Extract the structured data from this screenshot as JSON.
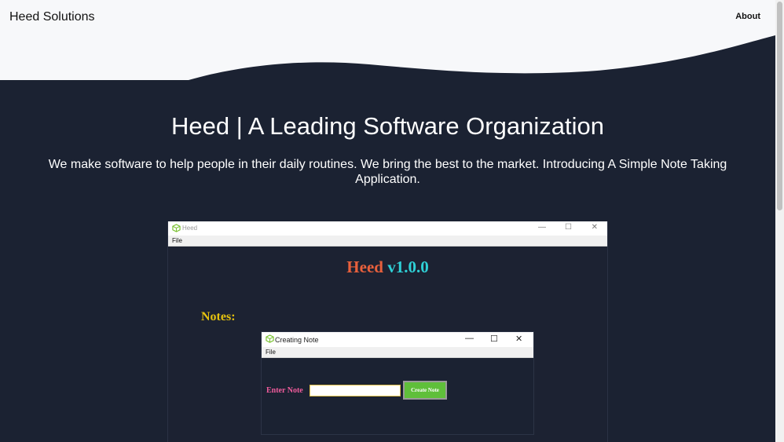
{
  "header": {
    "brand": "Heed Solutions",
    "nav": {
      "about": "About"
    }
  },
  "hero": {
    "title": "Heed | A Leading Software Organization",
    "subtitle": "We make software to help people in their daily routines. We bring the best to the market. Introducing A Simple Note Taking Application."
  },
  "app_screenshot": {
    "window_title": "Heed",
    "menu_file": "File",
    "heading_name": "Heed",
    "heading_version": "v1.0.0",
    "notes_label": "Notes:",
    "dialog": {
      "title": "Creating Note",
      "menu_file": "File",
      "enter_label": "Enter Note",
      "input_value": "",
      "create_button": "Create Note"
    }
  },
  "colors": {
    "background": "#1b2232",
    "header_bg": "#f7f8fa",
    "heading_name": "#e8603c",
    "heading_version": "#2fd0d6",
    "notes_label": "#e5c20f",
    "enter_label": "#f05c9c",
    "create_button": "#5fbf3a"
  },
  "icons": [
    "cube-icon",
    "minimize-icon",
    "maximize-icon",
    "close-icon"
  ]
}
